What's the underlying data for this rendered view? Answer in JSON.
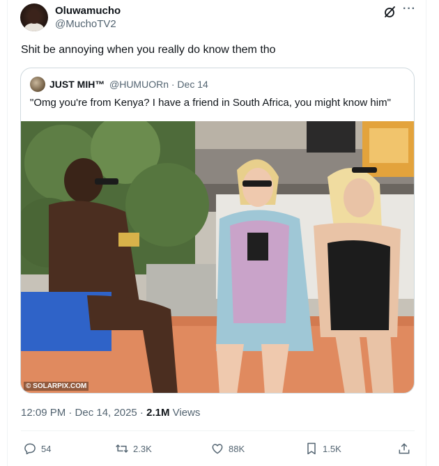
{
  "tweet": {
    "display_name": "Oluwamucho",
    "handle": "@MuchoTV2",
    "text": "Shit be annoying when you really do know them tho",
    "timestamp": "12:09 PM · Dec 14, 2025 · ",
    "views_count": "2.1M",
    "views_label": " Views"
  },
  "quoted": {
    "display_name": "JUST MIH™",
    "handle_date": "@HUMUORn · Dec 14",
    "text": "\"Omg you're from Kenya? I have a friend in South Africa, you might know him\"",
    "watermark": "© SOLARPIX.COM"
  },
  "actions": {
    "replies": "54",
    "reposts": "2.3K",
    "likes": "88K",
    "bookmarks": "1.5K"
  },
  "icons": {
    "header": [
      "grok-icon",
      "more-icon"
    ],
    "actions": [
      "reply-icon",
      "repost-icon",
      "like-icon",
      "bookmark-icon",
      "share-icon"
    ]
  },
  "colors": {
    "text_primary": "#0f1419",
    "text_secondary": "#536471",
    "border": "#cfd9de"
  }
}
